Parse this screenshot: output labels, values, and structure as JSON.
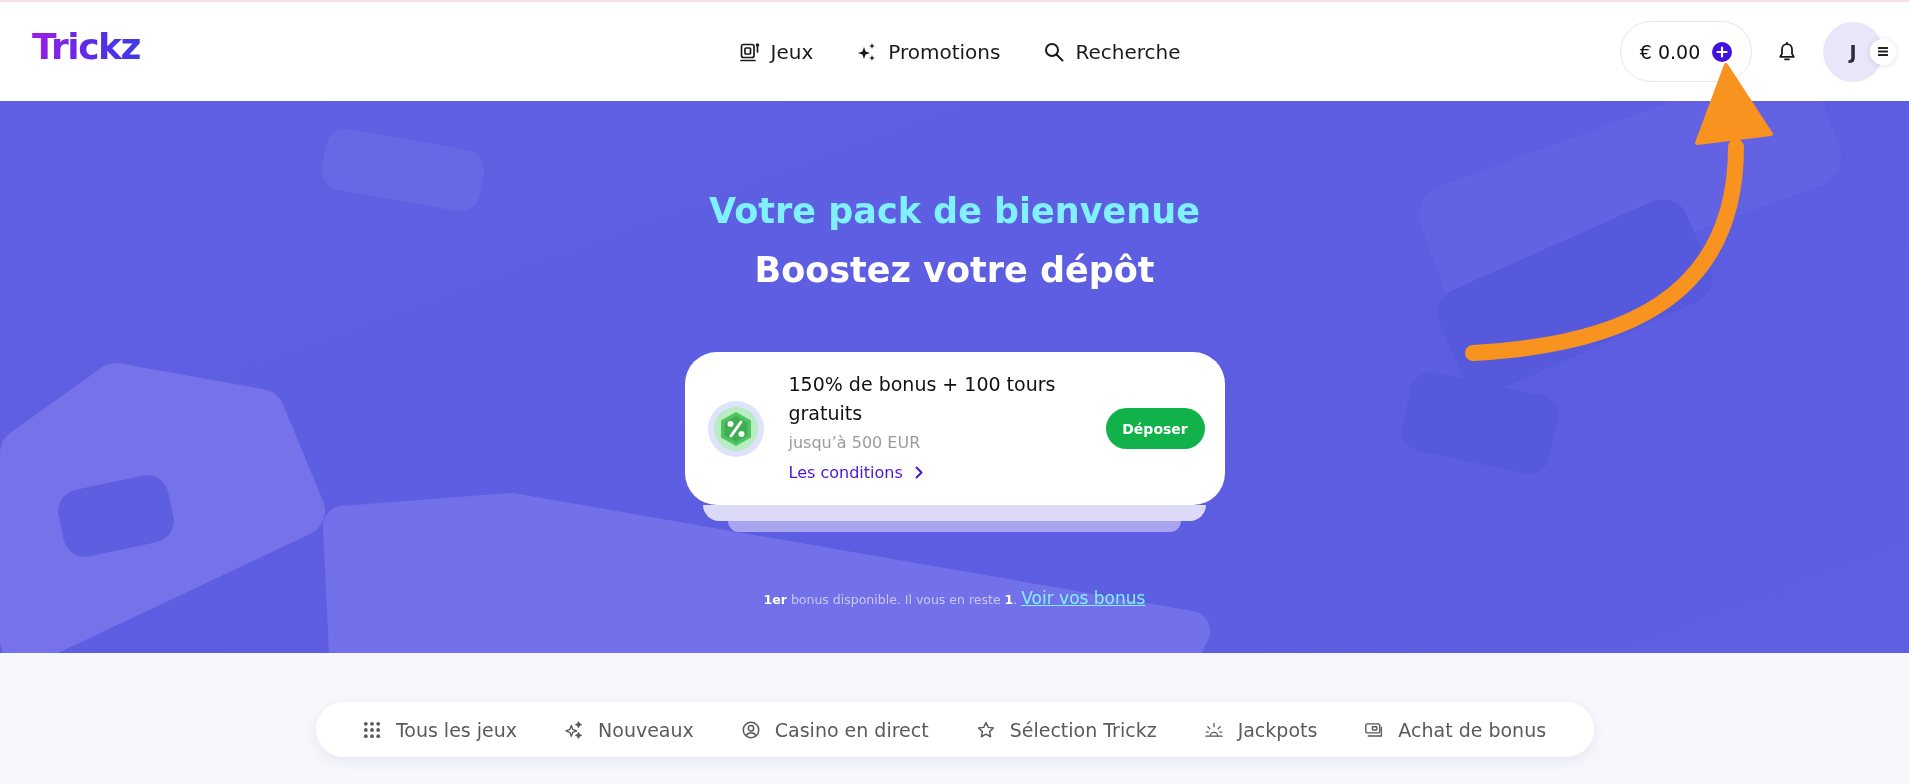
{
  "header": {
    "logo": "Trickz",
    "nav": [
      {
        "kind": "games",
        "label": "Jeux"
      },
      {
        "kind": "promotions",
        "label": "Promotions"
      },
      {
        "kind": "search",
        "label": "Recherche"
      }
    ],
    "balance": "€ 0.00",
    "avatar_initial": "J"
  },
  "hero": {
    "title": "Votre pack de bienvenue",
    "subtitle": "Boostez votre dépôt",
    "offer": {
      "title": "150% de bonus + 100 tours gratuits",
      "limit": "jusqu’à 500 EUR",
      "conditions_link": "Les conditions",
      "deposit_button": "Déposer"
    },
    "note": "**1er** bonus disponible. Il vous en reste **1**.",
    "note_link": "Voir vos bonus"
  },
  "categories": [
    {
      "kind": "all",
      "label": "Tous les jeux"
    },
    {
      "kind": "new",
      "label": "Nouveaux"
    },
    {
      "kind": "live",
      "label": "Casino en direct"
    },
    {
      "kind": "selection",
      "label": "Sélection Trickz"
    },
    {
      "kind": "jackpots",
      "label": "Jackpots"
    },
    {
      "kind": "bonus_buy",
      "label": "Achat de bonus"
    }
  ]
}
